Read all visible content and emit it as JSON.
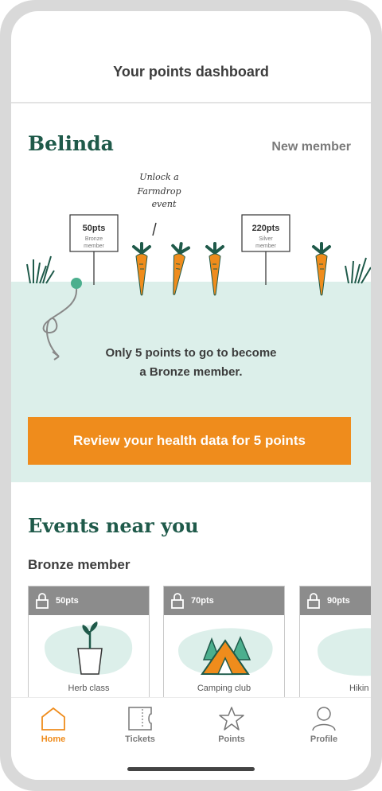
{
  "header": {
    "title": "Your points dashboard"
  },
  "user": {
    "name": "Belinda",
    "status": "New member"
  },
  "garden": {
    "annotation": [
      "Unlock a",
      "Farmdrop",
      "event"
    ],
    "milestones": [
      {
        "points": "50pts",
        "line1": "Bronze",
        "line2": "member"
      },
      {
        "points": "220pts",
        "line1": "Silver",
        "line2": "member"
      }
    ]
  },
  "progress": {
    "line1": "Only 5 points to go to become",
    "line2": "a Bronze member."
  },
  "cta": {
    "label": "Review your health data for 5 points"
  },
  "events": {
    "title": "Events near you",
    "tier": "Bronze member",
    "cards": [
      {
        "points": "50pts",
        "label": "Herb class",
        "icon": "plant-pot-icon"
      },
      {
        "points": "70pts",
        "label": "Camping club",
        "icon": "tent-trees-icon"
      },
      {
        "points": "90pts",
        "label": "Hikin",
        "icon": "hiking-icon"
      }
    ]
  },
  "nav": [
    {
      "label": "Home",
      "icon": "home-icon",
      "active": true
    },
    {
      "label": "Tickets",
      "icon": "ticket-icon",
      "active": false
    },
    {
      "label": "Points",
      "icon": "star-icon",
      "active": false
    },
    {
      "label": "Profile",
      "icon": "person-icon",
      "active": false
    }
  ],
  "colors": {
    "accent": "#ef8c1c",
    "brand": "#1f5a4a",
    "ground": "#dcefea",
    "card_head": "#8c8c8c"
  }
}
